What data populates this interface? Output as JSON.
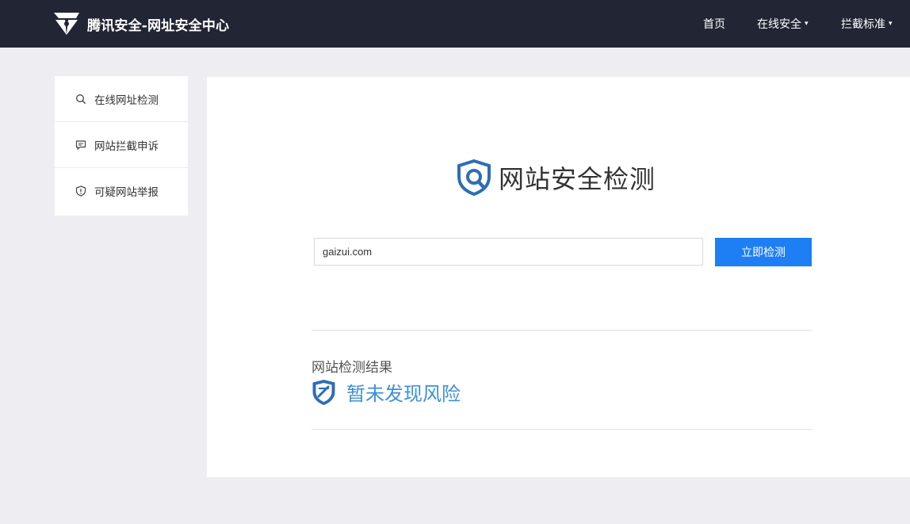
{
  "header": {
    "brand_title": "腾讯安全-网址安全中心",
    "logo_icon": "tencent-security-logo",
    "nav": [
      {
        "label": "首页",
        "has_dropdown": false
      },
      {
        "label": "在线安全",
        "has_dropdown": true
      },
      {
        "label": "拦截标准",
        "has_dropdown": true
      }
    ],
    "dropdown_glyph": "▾"
  },
  "sidebar": {
    "items": [
      {
        "label": "在线网址检测",
        "icon": "search-icon"
      },
      {
        "label": "网站拦截申诉",
        "icon": "message-icon"
      },
      {
        "label": "可疑网站举报",
        "icon": "shield-alert-icon"
      }
    ]
  },
  "main": {
    "title": "网站安全检测",
    "title_icon": "shield-search-icon",
    "search": {
      "value": "gaizui.com",
      "placeholder": ""
    },
    "check_button_label": "立即检测",
    "result": {
      "label": "网站检测结果",
      "status_text": "暂未发现风险",
      "status_icon": "shield-check-icon"
    }
  },
  "colors": {
    "topbar": "#222634",
    "page_bg": "#eeeef2",
    "accent_button": "#1e7ef3",
    "result_text": "#3d8fd8",
    "shield_blue": "#2f6db5"
  }
}
